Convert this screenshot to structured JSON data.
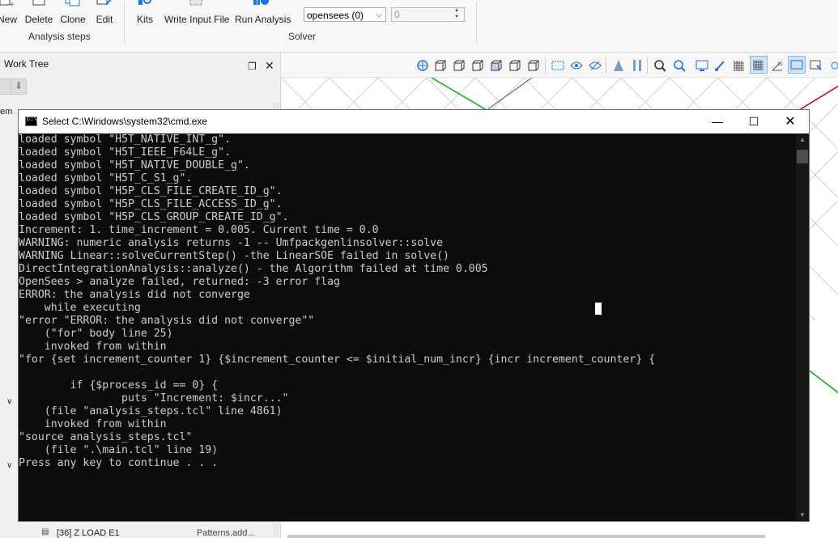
{
  "ribbon": {
    "btn_new": "New",
    "btn_delete": "Delete",
    "btn_clone": "Clone",
    "btn_edit": "Edit",
    "group_analysis": "Analysis steps",
    "btn_kits": "Kits",
    "btn_write": "Write Input File",
    "btn_run": "Run Analysis",
    "group_solver": "Solver",
    "solver_select": "opensees (0)",
    "processes_value": "0"
  },
  "left_panel": {
    "title": "Work Tree",
    "tree_item": "[36] Z LOAD E1",
    "tree_item_value": "Patterns.add...",
    "tree_label": "em"
  },
  "cmd": {
    "title": "Select C:\\Windows\\system32\\cmd.exe",
    "lines": [
      "loaded symbol \"H5T_NATIVE_INT_g\".",
      "loaded symbol \"H5T_IEEE_F64LE_g\".",
      "loaded symbol \"H5T_NATIVE_DOUBLE_g\".",
      "loaded symbol \"H5T_C_S1_g\".",
      "loaded symbol \"H5P_CLS_FILE_CREATE_ID_g\".",
      "loaded symbol \"H5P_CLS_FILE_ACCESS_ID_g\".",
      "loaded symbol \"H5P_CLS_GROUP_CREATE_ID_g\".",
      "Increment: 1. time_increment = 0.005. Current time = 0.0",
      "WARNING: numeric analysis returns -1 -- Umfpackgenlinsolver::solve",
      "WARNING Linear::solveCurrentStep() -the LinearSOE failed in solve()",
      "DirectIntegrationAnalysis::analyze() - the Algorithm failed at time 0.005",
      "OpenSees > analyze failed, returned: -3 error flag",
      "ERROR: the analysis did not converge",
      "    while executing",
      "\"error \"ERROR: the analysis did not converge\"\"",
      "    (\"for\" body line 25)",
      "    invoked from within",
      "\"for {set increment_counter 1} {$increment_counter <= $initial_num_incr} {incr increment_counter} {",
      "",
      "        if {$process_id == 0} {",
      "                puts \"Increment: $incr...\"",
      "    (file \"analysis_steps.tcl\" line 4861)",
      "    invoked from within",
      "\"source analysis_steps.tcl\"",
      "    (file \".\\main.tcl\" line 19)",
      "Press any key to continue . . ."
    ]
  },
  "colors": {
    "console_bg": "#0c0c0c",
    "console_fg": "#cccccc",
    "axis_green": "#00b400",
    "axis_red": "#d00000"
  }
}
